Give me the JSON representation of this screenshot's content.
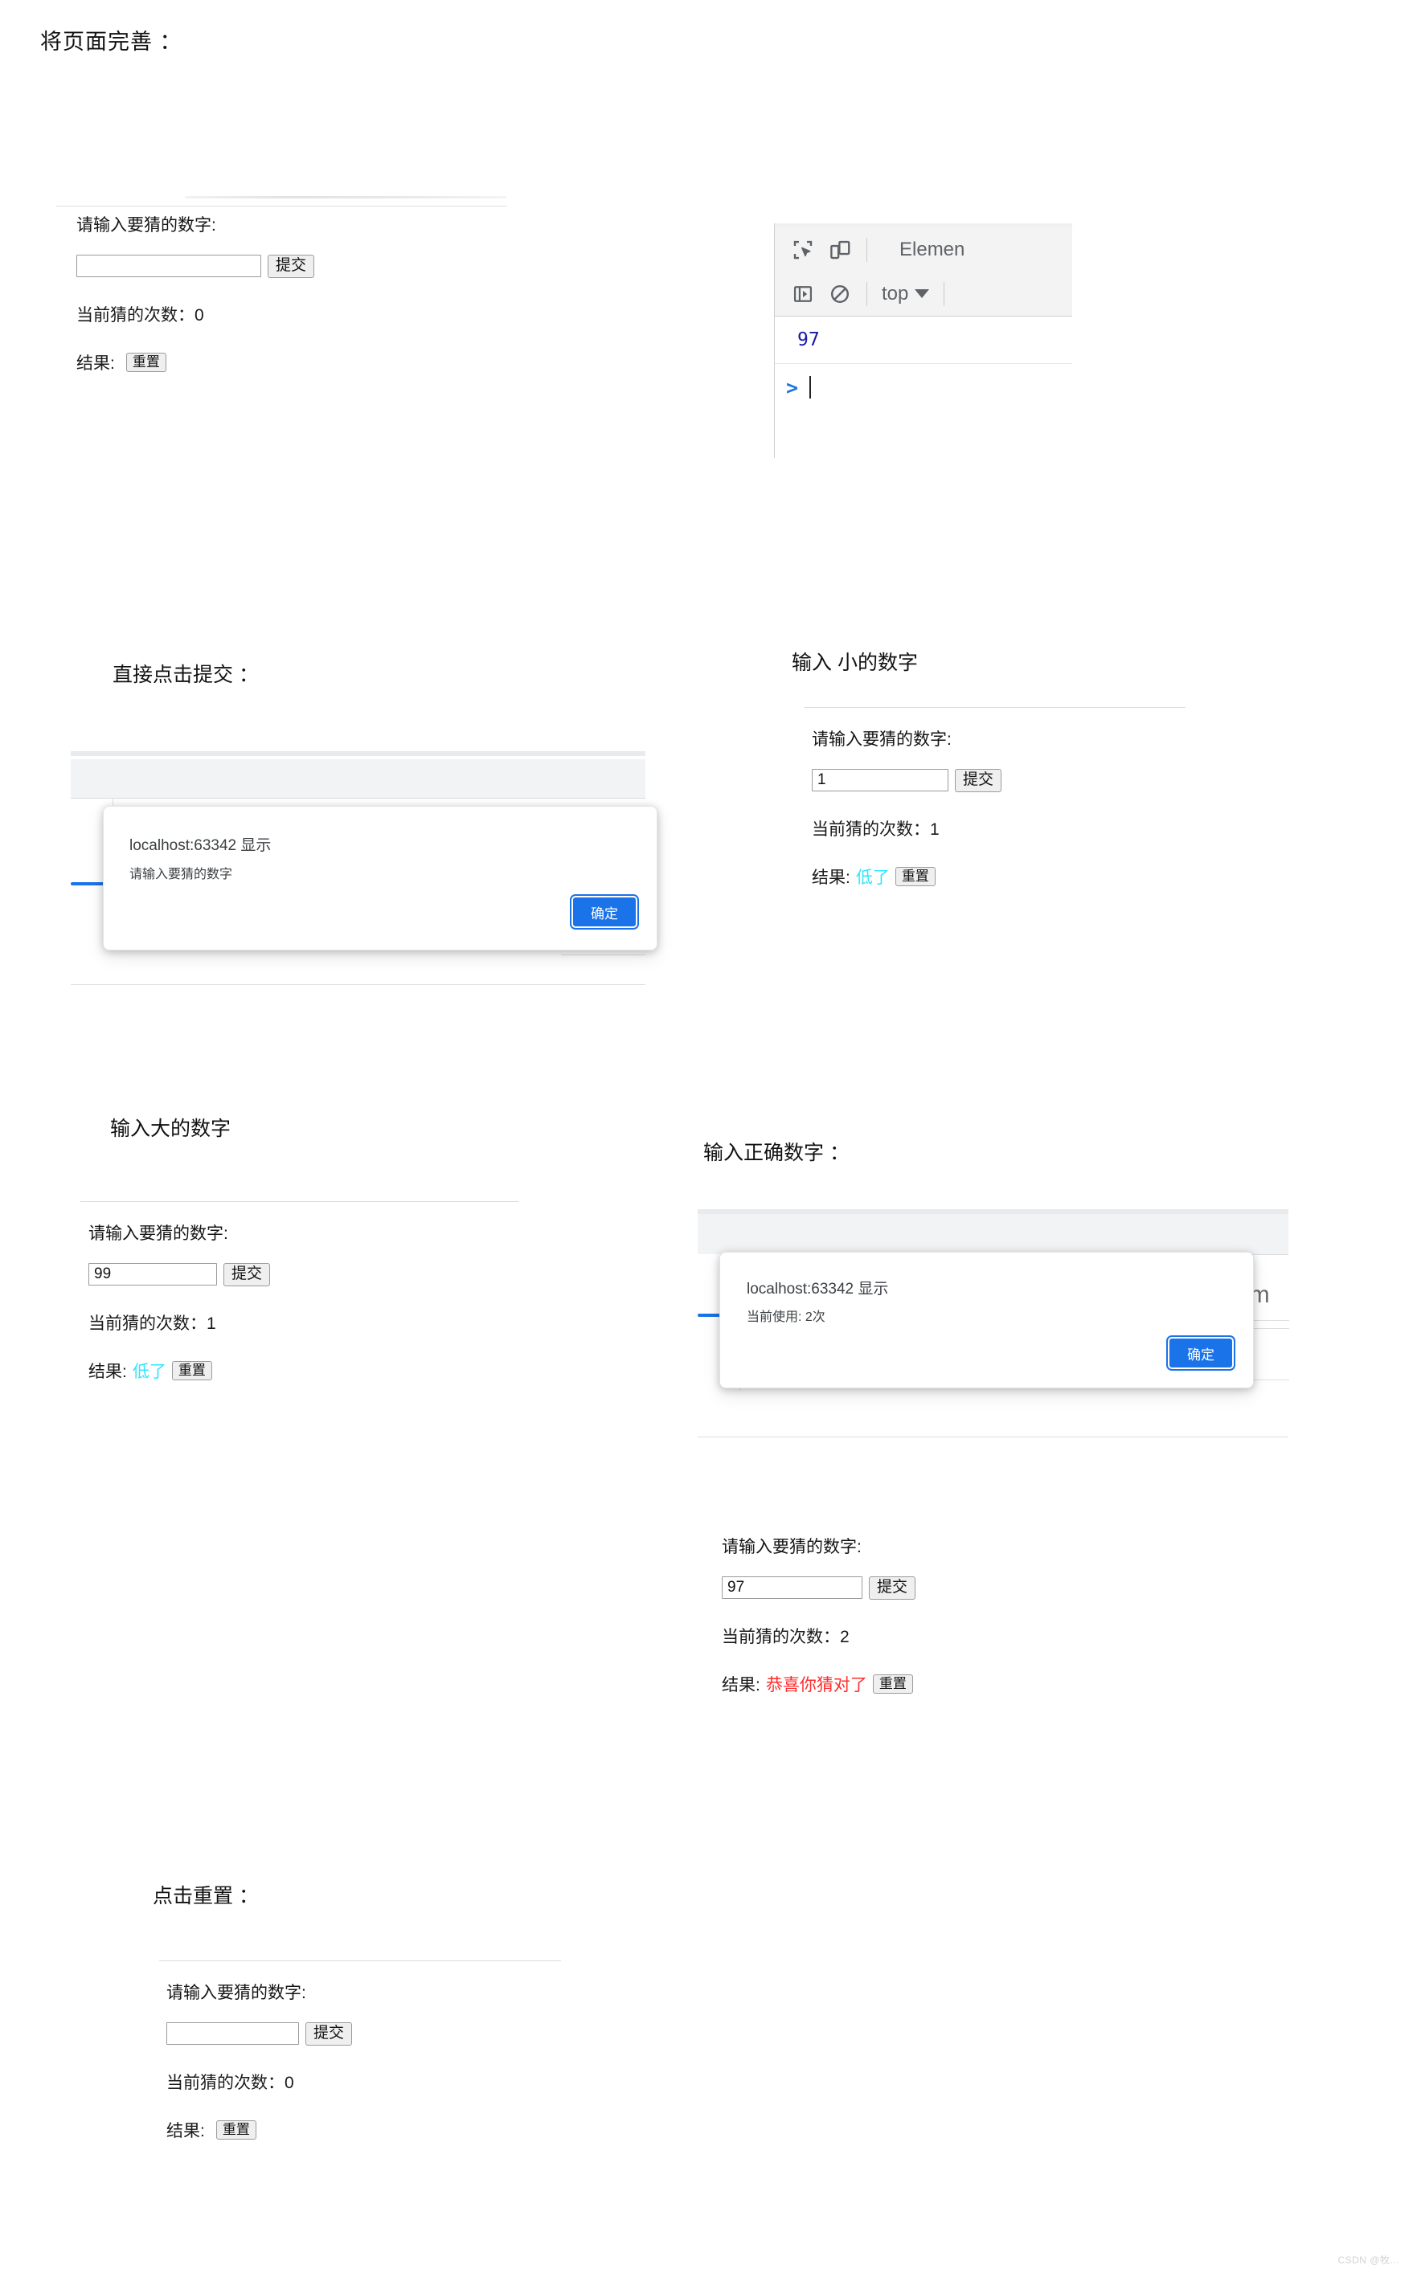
{
  "page": {
    "title": "将页面完善 ："
  },
  "sections": {
    "direct_submit_caption": "直接点击提交 ：",
    "small_number_caption": "输入 小的数字",
    "big_number_caption": "输入大的数字",
    "correct_number_caption": "输入正确数字 ：",
    "reset_caption": "点击重置 ："
  },
  "game_common": {
    "prompt_label": "请输入要猜的数字:",
    "submit_label": "提交",
    "reset_label": "重置",
    "count_prefix": "当前猜的次数：",
    "result_prefix": "结果:",
    "input_placeholder": ""
  },
  "game_states": {
    "initial": {
      "input_value": "",
      "count": "0",
      "count_text": "当前猜的次数：0",
      "result_text": "",
      "result_color": ""
    },
    "small_guess": {
      "input_value": "1",
      "count": "1",
      "count_text": "当前猜的次数：1",
      "result_text": "低了",
      "result_color": "#2fe6ff"
    },
    "big_guess": {
      "input_value": "99",
      "count": "1",
      "count_text": "当前猜的次数：1",
      "result_text": "低了",
      "result_color": "#2fe6ff"
    },
    "correct_guess": {
      "input_value": "97",
      "count": "2",
      "count_text": "当前猜的次数：2",
      "result_text": "恭喜你猜对了",
      "result_color": "#ff2d2d"
    },
    "after_reset": {
      "input_value": "",
      "count": "0",
      "count_text": "当前猜的次数：0",
      "result_text": "",
      "result_color": ""
    }
  },
  "alerts": {
    "empty_input": {
      "origin": "localhost:63342 显示",
      "message": "请输入要猜的数字",
      "ok_label": "确定"
    },
    "win": {
      "origin": "localhost:63342 显示",
      "message": "当前使用: 2次",
      "ok_label": "确定"
    }
  },
  "devtools": {
    "inspect_icon": "inspect-element-icon",
    "device_icon": "device-toolbar-icon",
    "elements_tab": "Elemen",
    "sidebar_toggle_icon": "console-sidebar-icon",
    "clear_icon": "clear-console-icon",
    "context_selector": "top",
    "caret_icon": "chevron-down-icon",
    "console_output": "97",
    "prompt_arrow": ">"
  },
  "devtools_ghost": {
    "performance_tab": "orm"
  },
  "watermark": {
    "text": "CSDN @牧..."
  },
  "colors": {
    "accent_blue": "#1a73e8",
    "result_low": "#2fe6ff",
    "result_win": "#ff2d2d",
    "console_value": "#1a1aa6"
  }
}
